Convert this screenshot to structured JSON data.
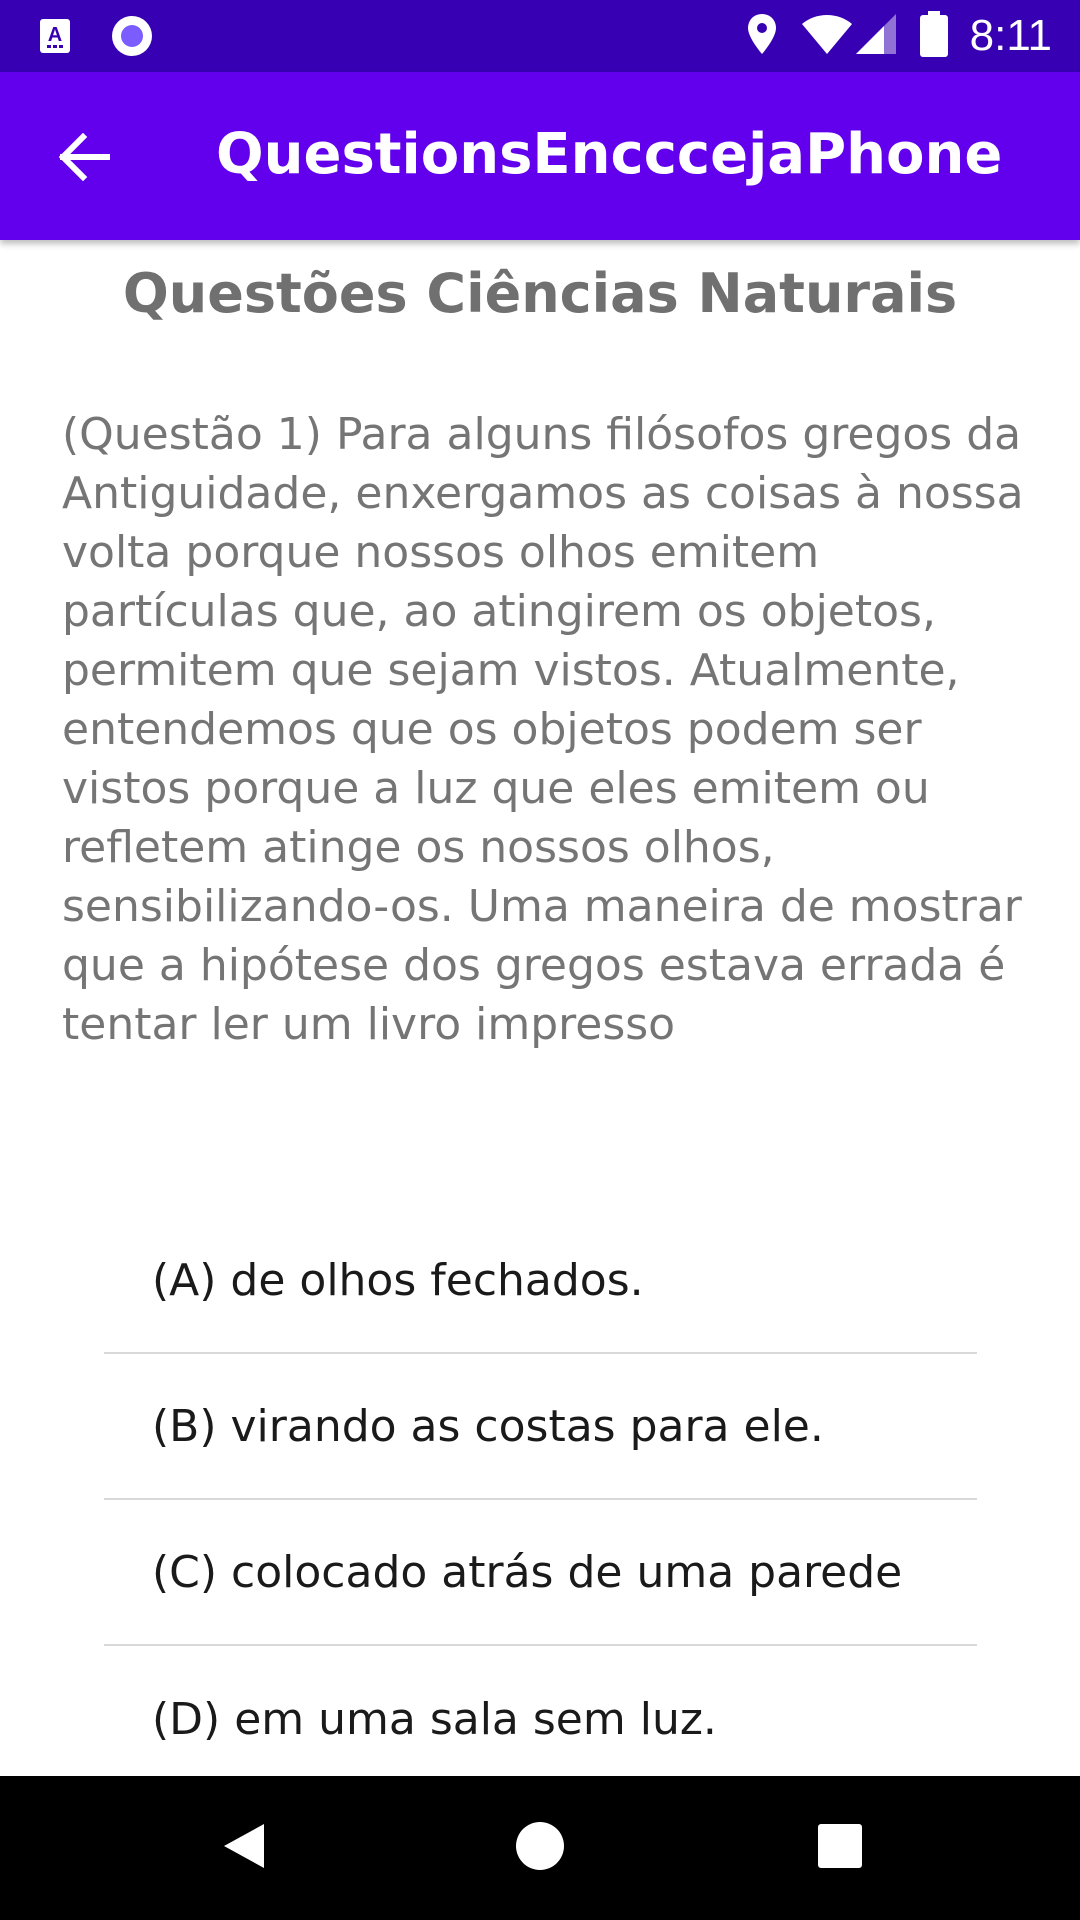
{
  "status_bar": {
    "time": "8:11",
    "icons": [
      "text-input-notification-icon",
      "record-icon",
      "location-icon",
      "wifi-icon",
      "signal-icon",
      "battery-icon"
    ]
  },
  "app_bar": {
    "title": "QuestionsEncccejaPhone",
    "back_icon": "arrow-back-icon",
    "color": "#6200EE"
  },
  "page": {
    "title": "Questões Ciências Naturais",
    "question": "(Questão 1) Para alguns filósofos gregos da Antiguidade, enxergamos as coisas à nossa volta porque nossos olhos emitem partículas que, ao atingirem os objetos, permitem que sejam vistos. Atualmente, entendemos que os objetos podem ser vistos porque a luz que eles emitem ou refletem atinge os nossos olhos, sensibilizando-os. Uma maneira de mostrar que a hipótese dos gregos estava errada é tentar ler um livro impresso",
    "options": [
      "(A) de olhos fechados.",
      "(B) virando as costas para ele.",
      "(C) colocado atrás de uma parede",
      "(D) em uma sala sem luz."
    ]
  },
  "nav_bar": {
    "icons": [
      "back-triangle-icon",
      "home-circle-icon",
      "recents-square-icon"
    ]
  },
  "colors": {
    "status_bar": "#3700B3",
    "app_bar": "#6200EE",
    "title_text": "#707070",
    "question_text": "#757575"
  }
}
